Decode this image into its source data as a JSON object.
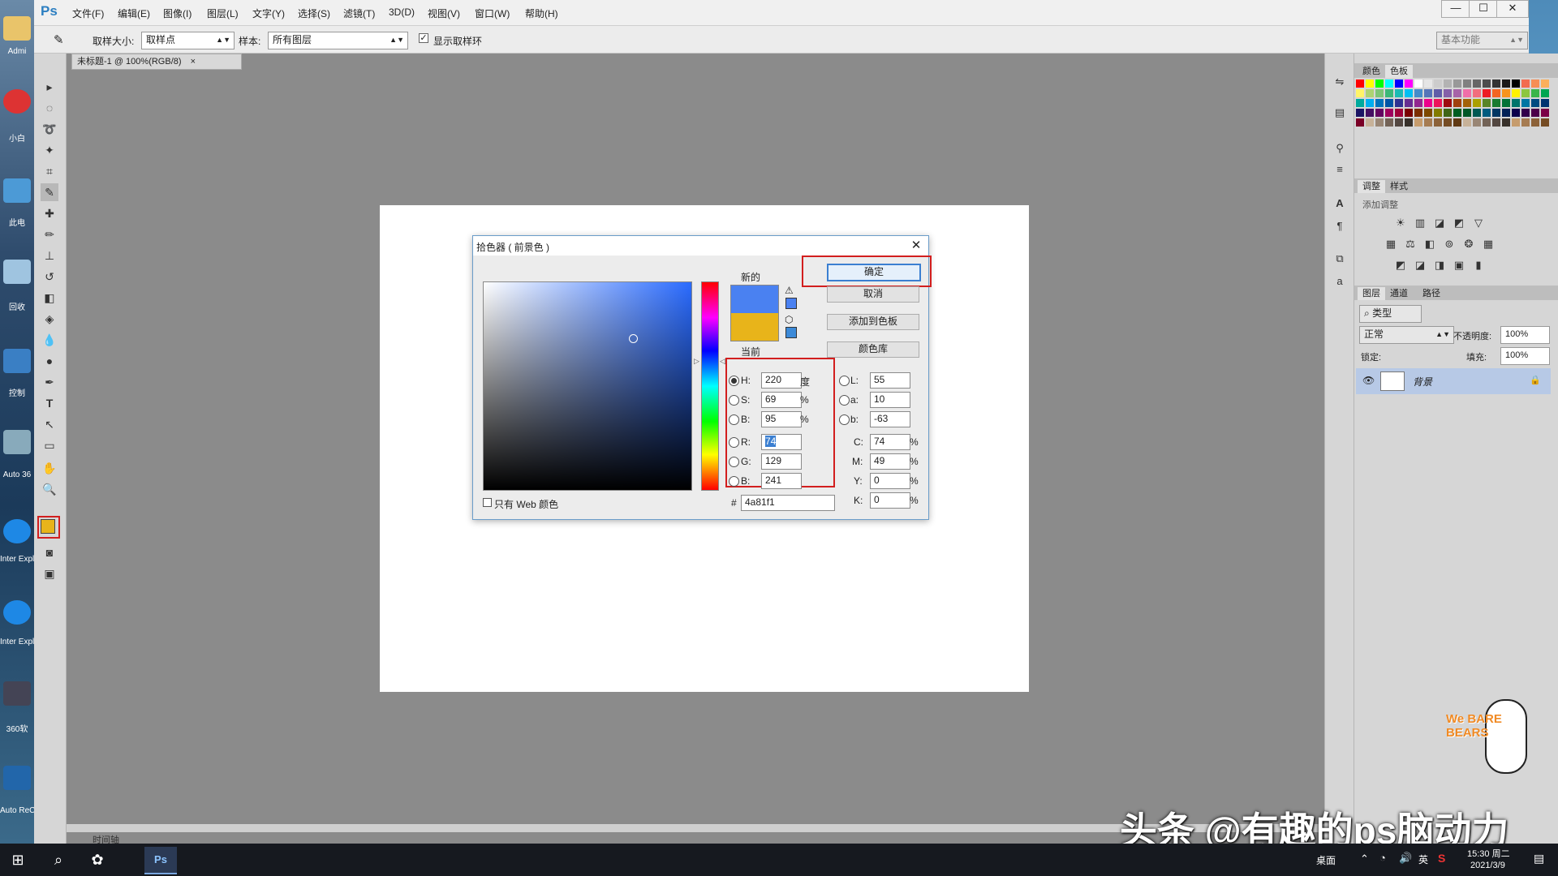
{
  "desktop": {
    "labels": [
      "Admi",
      "小白",
      "此电",
      "回收",
      "控制",
      "Auto 36",
      "Inter Explo",
      "Inter Explo",
      "360软",
      "Auto ReC"
    ]
  },
  "app": {
    "logo": "Ps"
  },
  "menu": [
    "文件(F)",
    "编辑(E)",
    "图像(I)",
    "图层(L)",
    "文字(Y)",
    "选择(S)",
    "滤镜(T)",
    "3D(D)",
    "视图(V)",
    "窗口(W)",
    "帮助(H)"
  ],
  "window_controls": [
    "—",
    "☐",
    "✕"
  ],
  "options": {
    "sample_size_label": "取样大小:",
    "sample_size_value": "取样点",
    "sample_label": "样本:",
    "sample_value": "所有图层",
    "show_ring_label": "显示取样环",
    "show_ring_checked": true,
    "workspace": "基本功能"
  },
  "document": {
    "tab": "未标题-1 @ 100%(RGB/8)",
    "tab_close": "×"
  },
  "timeline": "时间轴",
  "panels": {
    "swatches_tabs": [
      "颜色",
      "色板"
    ],
    "adjust_tabs": [
      "调整",
      "样式"
    ],
    "adjust_add": "添加调整",
    "layers_tabs": [
      "图层",
      "通道",
      "路径"
    ],
    "layers_filter": "类型",
    "blend_mode": "正常",
    "opacity_label": "不透明度:",
    "opacity_value": "100%",
    "lock_label": "锁定:",
    "fill_label": "填充:",
    "fill_value": "100%",
    "layer_name": "背景"
  },
  "dialog": {
    "title": "拾色器 ( 前景色 )",
    "close": "✕",
    "new_label": "新的",
    "current_label": "当前",
    "buttons": {
      "ok": "确定",
      "cancel": "取消",
      "add_swatch": "添加到色板",
      "libraries": "颜色库"
    },
    "hsb": {
      "h_label": "H:",
      "h": "220",
      "h_unit": "度",
      "s_label": "S:",
      "s": "69",
      "s_unit": "%",
      "b_label": "B:",
      "b": "95",
      "b_unit": "%"
    },
    "rgb": {
      "r_label": "R:",
      "r": "74",
      "g_label": "G:",
      "g": "129",
      "b_label": "B:",
      "b": "241"
    },
    "lab": {
      "l_label": "L:",
      "l": "55",
      "a_label": "a:",
      "a": "10",
      "b_label": "b:",
      "b": "-63"
    },
    "cmyk": {
      "c_label": "C:",
      "c": "74",
      "m_label": "M:",
      "m": "49",
      "y_label": "Y:",
      "y": "0",
      "k_label": "K:",
      "k": "0",
      "unit": "%"
    },
    "hex_label": "#",
    "hex": "4a81f1",
    "web_only": "只有 Web 颜色",
    "new_color": "#4a81f1",
    "current_color": "#e8b41a"
  },
  "foreground_color": "#e8b41a",
  "taskbar": {
    "desktop": "桌面",
    "ime": "英",
    "time": "15:30 周二",
    "date": "2021/3/9"
  },
  "watermark": "头条 @有趣的ps脑动力",
  "sticker": "We BARE BEARS"
}
